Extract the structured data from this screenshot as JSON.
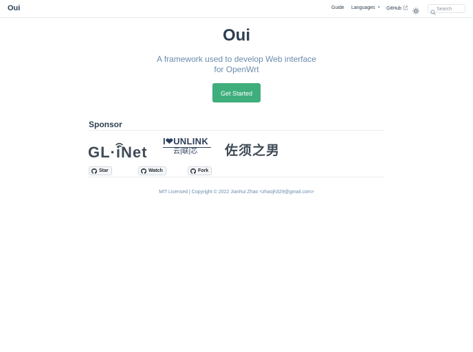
{
  "navbar": {
    "brand": "Oui",
    "links": {
      "guide": "Guide",
      "languages": "Languages",
      "github": "GitHub"
    },
    "search_placeholder": "Search"
  },
  "hero": {
    "title": "Oui",
    "description": "A framework used to develop Web interface for OpenWrt",
    "cta_label": "Get Started"
  },
  "sponsor": {
    "heading": "Sponsor",
    "logos": {
      "glinet": "GL·iNet",
      "yunlink_main": "I❤UNLINK",
      "yunlink_sub": "云|联|芯",
      "cn": "佐须之男"
    }
  },
  "github_buttons": {
    "star": "Star",
    "watch": "Watch",
    "fork": "Fork"
  },
  "footer": {
    "text": "MIT Licensed | Copyright © 2022 Jianhui Zhao <zhaojh329@gmail.com>"
  },
  "colors": {
    "accent": "#3eaf7c",
    "text": "#2c3e50",
    "muted": "#6a8bad",
    "border": "#eaecef"
  },
  "icons": [
    "search-icon",
    "sun-icon",
    "external-link-icon",
    "github-icon",
    "chevron-down-icon"
  ]
}
